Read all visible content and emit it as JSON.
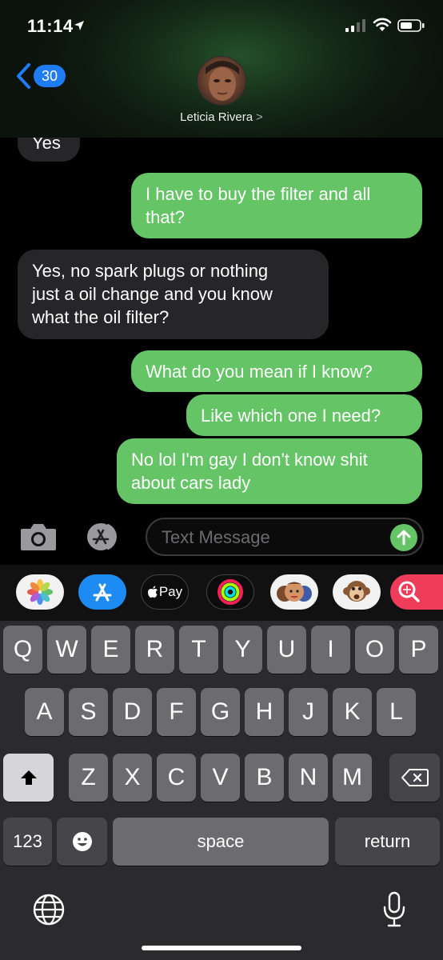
{
  "status_bar": {
    "time": "11:14"
  },
  "header": {
    "back_count": "30",
    "contact_name": "Leticia Rivera",
    "name_chevron": ">"
  },
  "messages": [
    {
      "id": "m1",
      "direction": "incoming",
      "lines": [
        "Yes"
      ]
    },
    {
      "id": "m2",
      "direction": "outgoing",
      "lines": [
        "I have to buy the filter and all",
        "that?"
      ]
    },
    {
      "id": "m3",
      "direction": "incoming",
      "lines": [
        "Yes, no spark plugs or nothing",
        "just a oil change and you know",
        "what the oil filter?"
      ]
    },
    {
      "id": "m4",
      "direction": "outgoing",
      "lines": [
        "What do you mean if I know?"
      ]
    },
    {
      "id": "m5",
      "direction": "outgoing",
      "lines": [
        "Like which one I need?"
      ]
    },
    {
      "id": "m6",
      "direction": "outgoing",
      "lines": [
        "No lol I'm gay I don't know shit",
        "about cars lady"
      ]
    }
  ],
  "input": {
    "placeholder": "Text Message"
  },
  "app_drawer": {
    "apple_pay_label": "Pay",
    "apps": [
      "photos-icon",
      "app-store-icon",
      "apple-pay-icon",
      "activity-icon",
      "memoji-icon",
      "animoji-monkey-icon",
      "search-images-icon"
    ]
  },
  "keyboard": {
    "row1": [
      "Q",
      "W",
      "E",
      "R",
      "T",
      "Y",
      "U",
      "I",
      "O",
      "P"
    ],
    "row2": [
      "A",
      "S",
      "D",
      "F",
      "G",
      "H",
      "J",
      "K",
      "L"
    ],
    "row3": [
      "Z",
      "X",
      "C",
      "V",
      "B",
      "N",
      "M"
    ],
    "numbers_key": "123",
    "space_key": "space",
    "return_key": "return"
  },
  "colors": {
    "outgoing_bubble": "#65c466",
    "incoming_bubble": "#262628",
    "badge": "#1f7cf5"
  }
}
